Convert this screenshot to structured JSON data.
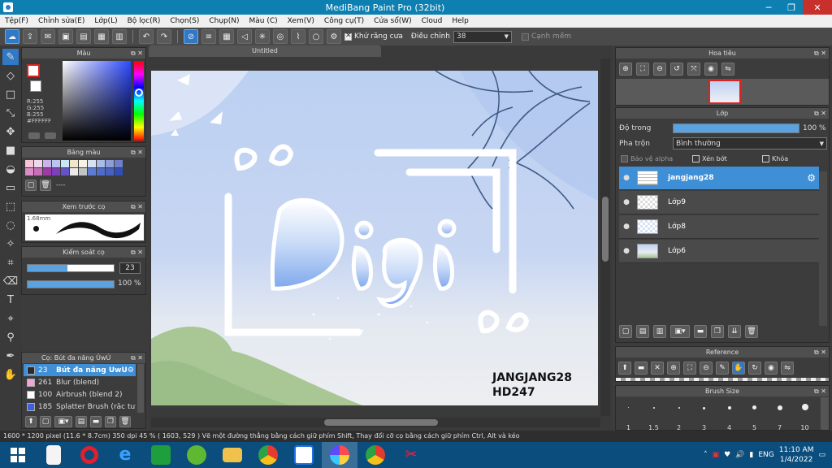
{
  "window": {
    "title": "MediBang Paint Pro (32bit)",
    "min": "─",
    "max": "❐",
    "close": "✕"
  },
  "menu": [
    "Tệp(F)",
    "Chỉnh sửa(E)",
    "Lớp(L)",
    "Bộ lọc(R)",
    "Chọn(S)",
    "Chụp(N)",
    "Màu (C)",
    "Xem(V)",
    "Công cụ(T)",
    "Cửa sổ(W)",
    "Cloud",
    "Help"
  ],
  "toolbar": {
    "antialias_label": "Khử răng cưa",
    "adjust_label": "Điều chỉnh",
    "adjust_value": "38",
    "smooth_label": "Cạnh mềm"
  },
  "color_panel": {
    "title": "Màu",
    "r": "R:255",
    "g": "G:255",
    "b": "B:255",
    "hex": "#FFFFFF"
  },
  "palette_panel": {
    "title": "Bảng màu",
    "dash": "----"
  },
  "brush_preview": {
    "title": "Xem trước cọ",
    "size": "1.68mm"
  },
  "brush_control": {
    "title": "Kiểm soát cọ",
    "size_value": "23",
    "opacity_value": "100 %"
  },
  "brush_list": {
    "title": "Cọ: Bút đa năng ỦwÚ",
    "items": [
      {
        "size": "23",
        "name": "Bút đa năng ỦwÚ",
        "color": "#2a2a2a",
        "selected": true
      },
      {
        "size": "261",
        "name": "Blur (blend)",
        "color": "#f3a4d6",
        "selected": false
      },
      {
        "size": "100",
        "name": "Airbrush (blend 2)",
        "color": "#ffffff",
        "selected": false
      },
      {
        "size": "185",
        "name": "Splatter Brush (rắc tuyết)",
        "color": "#3f5fe0",
        "selected": false
      }
    ]
  },
  "document": {
    "tab": "Untitled"
  },
  "artwork": {
    "main_text": "Digi",
    "signature_line1": "JANGJANG28",
    "signature_line2": "HD247"
  },
  "navigator": {
    "title": "Hoa tiêu"
  },
  "layer_panel": {
    "title": "Lớp",
    "opacity_label": "Độ trong",
    "opacity_value": "100 %",
    "opacity_fraction": 1.0,
    "blend_label": "Pha trộn",
    "blend_value": "Bình thường",
    "protect_alpha": "Bảo vệ alpha",
    "clipping": "Xén bớt",
    "lock": "Khóa",
    "layers": [
      {
        "name": "jangjang28",
        "selected": true
      },
      {
        "name": "Lớp9",
        "selected": false
      },
      {
        "name": "Lớp8",
        "selected": false
      },
      {
        "name": "Lớp6",
        "selected": false
      }
    ]
  },
  "reference": {
    "title": "Reference"
  },
  "brush_size": {
    "title": "Brush Size",
    "sizes": [
      "1",
      "1.5",
      "2",
      "3",
      "4",
      "5",
      "7",
      "10"
    ]
  },
  "status": {
    "text": "1600 * 1200 pixel   (11.6 * 8.7cm)   350 dpi   45 %   ( 1603, 529 )   Vẽ một đường thẳng bằng cách giữ phím Shift, Thay đổi cỡ cọ bằng cách giữ phím Ctrl, Alt và kéo"
  },
  "taskbar": {
    "lang": "ENG",
    "time": "11:10 AM",
    "date": "1/4/2022"
  }
}
